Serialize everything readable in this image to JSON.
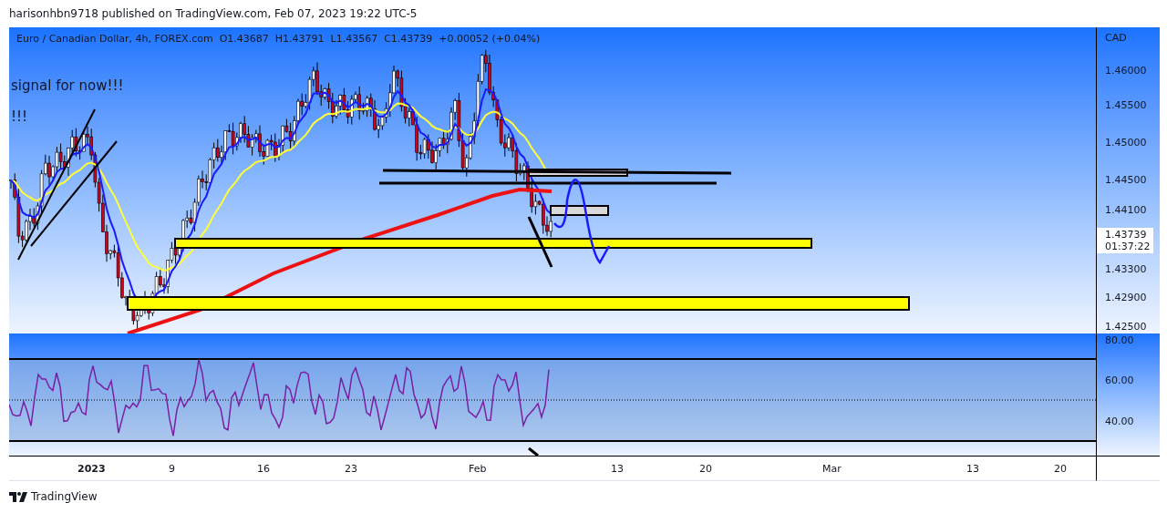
{
  "header": "harisonhbn9718 published on TradingView.com, Feb 07, 2023 19:22 UTC-5",
  "legend": "Euro / Canadian Dollar, 4h, FOREX.com  O1.43687  H1.43791  L1.43567  C1.43739  +0.00052 (+0.04%)",
  "annotations": [
    "signal for now!!!",
    "!!!"
  ],
  "price_axis": {
    "currency": "CAD",
    "ticks": [
      "1.46000",
      "1.45500",
      "1.45000",
      "1.44500",
      "1.44100",
      "1.43300",
      "1.42900",
      "1.42500"
    ],
    "last_price": "1.43739",
    "countdown": "01:37:22"
  },
  "rsi_axis": {
    "ticks": [
      "80.00",
      "60.00",
      "40.00"
    ]
  },
  "time_axis": [
    {
      "label": "2023",
      "kind": "year"
    },
    {
      "label": "9",
      "kind": "day"
    },
    {
      "label": "16",
      "kind": "day"
    },
    {
      "label": "23",
      "kind": "day"
    },
    {
      "label": "Feb",
      "kind": "month"
    },
    {
      "label": "13",
      "kind": "day"
    },
    {
      "label": "20",
      "kind": "day"
    },
    {
      "label": "Mar",
      "kind": "month"
    },
    {
      "label": "13",
      "kind": "day"
    },
    {
      "label": "20",
      "kind": "day"
    }
  ],
  "footer": {
    "brand": "TradingView"
  }
}
